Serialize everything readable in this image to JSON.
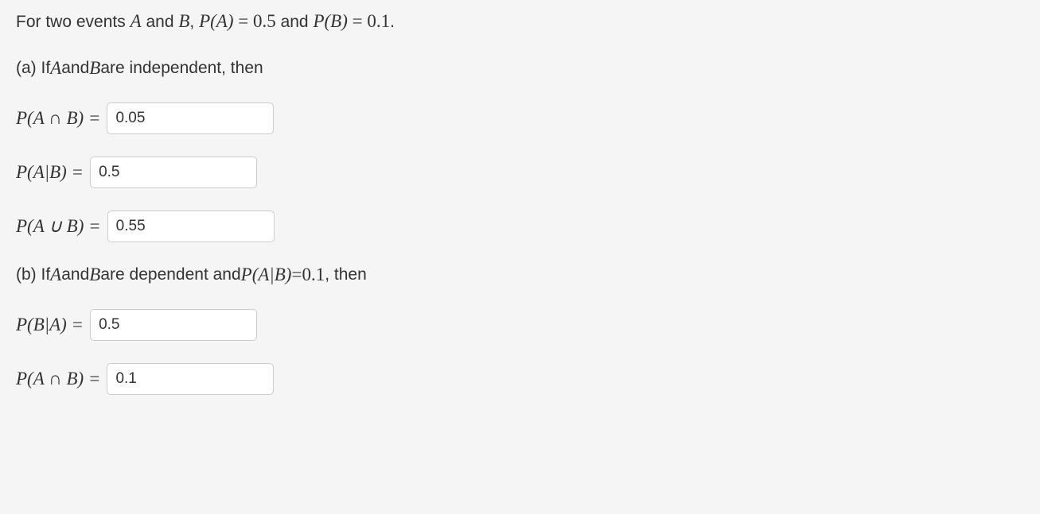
{
  "intro": {
    "prefix": "For two events ",
    "A": "A",
    "and1": " and ",
    "B": "B",
    "comma": ", ",
    "PA": "P(A)",
    "eq1": " = ",
    "PAval": "0.5",
    "and2": " and ",
    "PB": "P(B)",
    "eq2": " = ",
    "PBval": "0.1",
    "period": "."
  },
  "partA": {
    "label_prefix": "(a) If ",
    "A": "A",
    "and": " and ",
    "B": "B",
    "suffix": " are independent, then",
    "q1": {
      "label": "P(A ∩ B) = ",
      "value": "0.05"
    },
    "q2": {
      "label": "P(A|B) = ",
      "value": "0.5"
    },
    "q3": {
      "label": "P(A ∪ B) = ",
      "value": "0.55"
    }
  },
  "partB": {
    "label_prefix": "(b) If ",
    "A": "A",
    "and": " and ",
    "B": "B",
    "mid": " are dependent and ",
    "PAB": "P(A|B)",
    "eq": " = ",
    "PABval": "0.1",
    "suffix": ", then",
    "q1": {
      "label": "P(B|A) = ",
      "value": "0.5"
    },
    "q2": {
      "label": "P(A ∩ B) = ",
      "value": "0.1"
    }
  }
}
